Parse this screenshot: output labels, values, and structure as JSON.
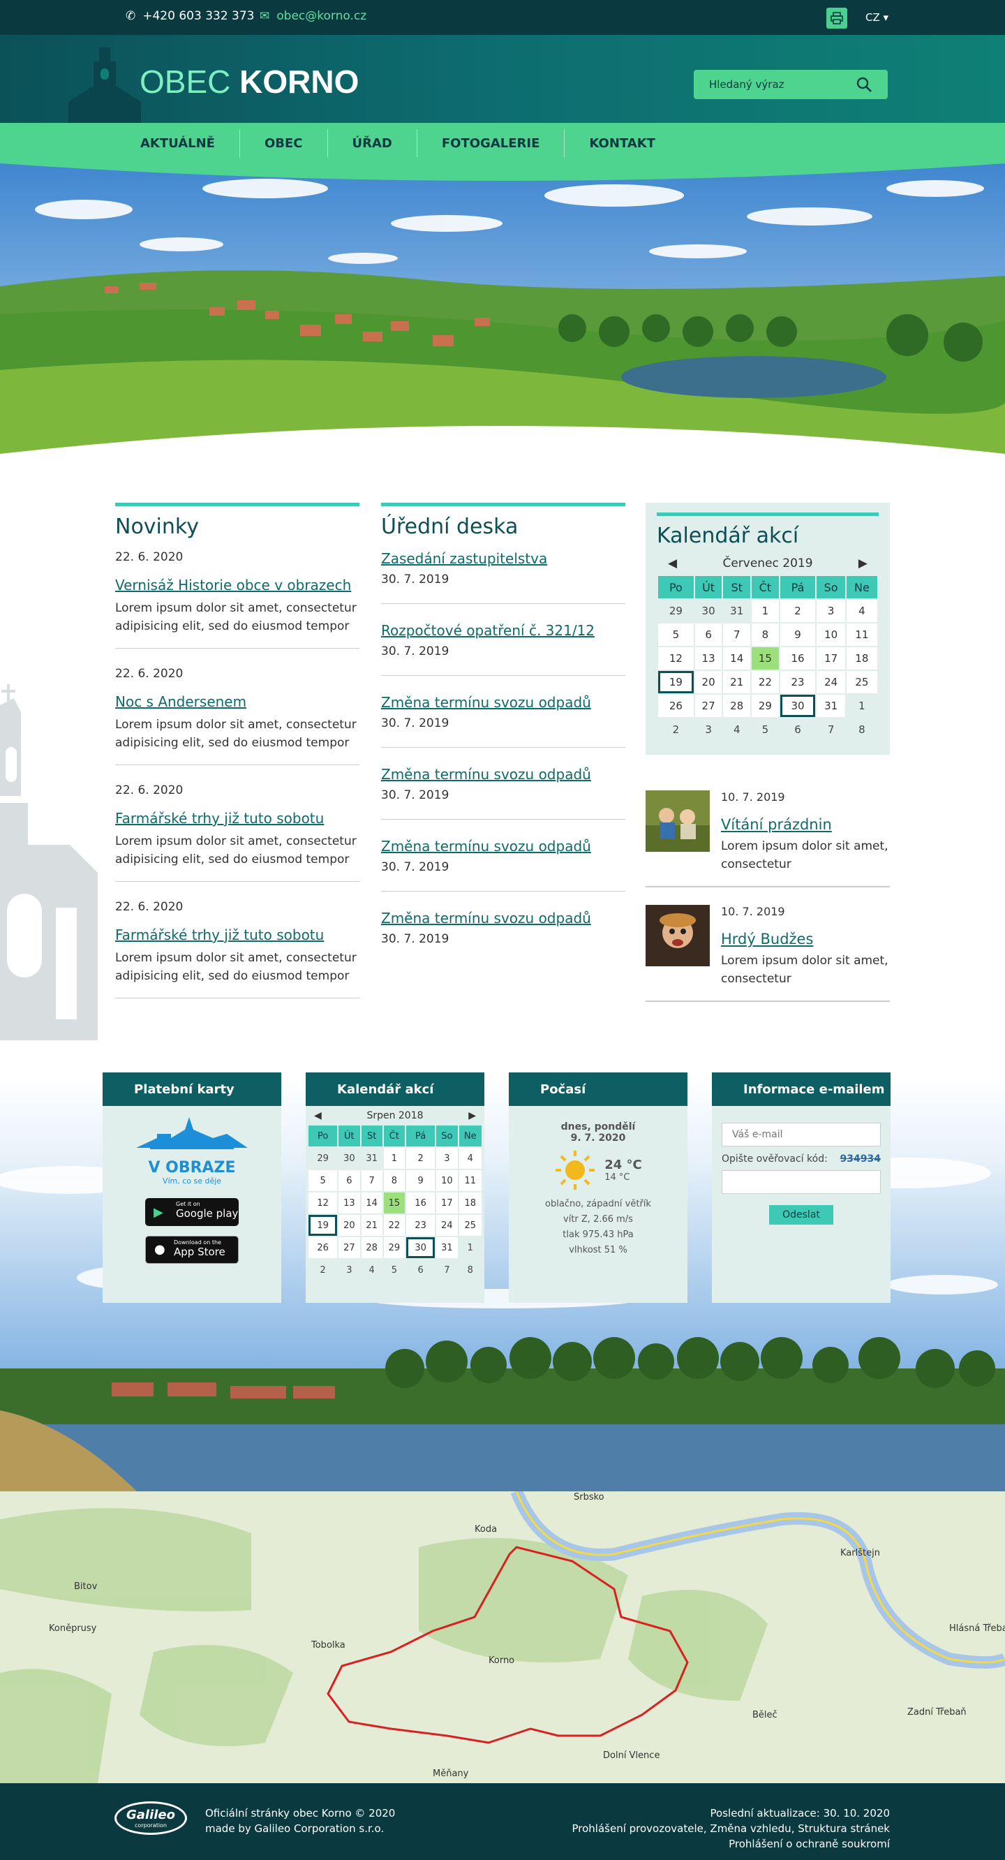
{
  "topbar": {
    "phone": "+420 603 332 373",
    "email": "obec@korno.cz",
    "lang": "CZ"
  },
  "header": {
    "logo_light": "OBEC",
    "logo_bold": "KORNO",
    "search_placeholder": "Hledaný výraz"
  },
  "nav": [
    "AKTUÁLNĚ",
    "OBEC",
    "ÚŘAD",
    "FOTOGALERIE",
    "KONTAKT"
  ],
  "news": {
    "title": "Novinky",
    "items": [
      {
        "date": "22. 6. 2020",
        "title": "Vernisáž Historie obce v obrazech",
        "text": "Lorem ipsum dolor sit amet, consectetur adipisicing elit, sed do eiusmod tempor"
      },
      {
        "date": "22. 6. 2020",
        "title": "Noc s Andersenem",
        "text": "Lorem ipsum dolor sit amet, consectetur adipisicing elit, sed do eiusmod tempor"
      },
      {
        "date": "22. 6. 2020",
        "title": "Farmářské trhy již tuto sobotu",
        "text": "Lorem ipsum dolor sit amet, consectetur adipisicing elit, sed do eiusmod tempor"
      },
      {
        "date": "22. 6. 2020",
        "title": "Farmářské trhy již tuto sobotu",
        "text": "Lorem ipsum dolor sit amet, consectetur adipisicing elit, sed do eiusmod tempor"
      }
    ]
  },
  "board": {
    "title": "Úřední deska",
    "items": [
      {
        "title": "Zasedání zastupitelstva",
        "date": "30. 7. 2019"
      },
      {
        "title": "Rozpočtové opatření č. 321/12",
        "date": "30. 7. 2019"
      },
      {
        "title": "Změna termínu svozu odpadů",
        "date": "30. 7. 2019"
      },
      {
        "title": "Změna termínu svozu odpadů",
        "date": "30. 7. 2019"
      },
      {
        "title": "Změna termínu svozu odpadů",
        "date": "30. 7. 2019"
      },
      {
        "title": "Změna termínu svozu odpadů",
        "date": "30. 7. 2019"
      }
    ]
  },
  "calendar": {
    "title": "Kalendář akcí",
    "month": "Červenec 2019",
    "weekdays": [
      "Po",
      "Út",
      "St",
      "Čt",
      "Pá",
      "So",
      "Ne"
    ],
    "weeks": [
      [
        "29",
        "30",
        "31",
        "1",
        "2",
        "3",
        "4"
      ],
      [
        "5",
        "6",
        "7",
        "8",
        "9",
        "10",
        "11"
      ],
      [
        "12",
        "13",
        "14",
        "15",
        "16",
        "17",
        "18"
      ],
      [
        "19",
        "20",
        "21",
        "22",
        "23",
        "24",
        "25"
      ],
      [
        "26",
        "27",
        "28",
        "29",
        "30",
        "31",
        "1"
      ],
      [
        "2",
        "3",
        "4",
        "5",
        "6",
        "7",
        "8"
      ]
    ]
  },
  "events": [
    {
      "date": "10. 7. 2019",
      "title": "Vítání prázdnin",
      "text": "Lorem ipsum dolor sit amet, consectetur"
    },
    {
      "date": "10. 7. 2019",
      "title": "Hrdý Budžes",
      "text": "Lorem ipsum dolor sit amet, consectetur"
    }
  ],
  "widgets": {
    "cards": {
      "title": "Platební karty",
      "brand": "V OBRAZE",
      "tagline": "Vím, co se děje",
      "google": "Get it on",
      "google2": "Google play",
      "apple": "Download on the",
      "apple2": "App Store"
    },
    "cal2": {
      "title": "Kalendář akcí",
      "month": "Srpen 2018",
      "weeks": [
        [
          "29",
          "30",
          "31",
          "1",
          "2",
          "3",
          "4"
        ],
        [
          "5",
          "6",
          "7",
          "8",
          "9",
          "10",
          "11"
        ],
        [
          "12",
          "13",
          "14",
          "15",
          "16",
          "17",
          "18"
        ],
        [
          "19",
          "20",
          "21",
          "22",
          "23",
          "24",
          "25"
        ],
        [
          "26",
          "27",
          "28",
          "29",
          "30",
          "31",
          "1"
        ],
        [
          "2",
          "3",
          "4",
          "5",
          "6",
          "7",
          "8"
        ]
      ]
    },
    "weather": {
      "title": "Počasí",
      "day": "dnes, pondělí",
      "date": "9. 7. 2020",
      "temp": "24 °C",
      "temp2": "14 °C",
      "l1": "oblačno, západní větřík",
      "l2": "vítr Z, 2.66 m/s",
      "l3": "tlak 975.43 hPa",
      "l4": "vlhkost 51 %"
    },
    "email": {
      "title": "Informace e-mailem",
      "placeholder": "Váš e-mail",
      "captcha_label": "Opište ověřovací kód:",
      "captcha": "934934",
      "submit": "Odeslat"
    }
  },
  "map": {
    "labels": [
      "Srbsko",
      "Karlštejn",
      "Koda",
      "Bitov",
      "Koněprusy",
      "Tobolka",
      "Korno",
      "Běleč",
      "Hlásná Třebaň",
      "Zadní Třebaň",
      "Měňany",
      "Dolní Vlence"
    ]
  },
  "footer": {
    "l1": "Oficiální stránky obec Korno © 2020",
    "l2": "made by",
    "l2link": "Galileo Corporation s.r.o.",
    "r1": "Poslední aktualizace: 30. 10. 2020",
    "r2a": "Prohlášení provozovatele",
    "r2b": "Změna vzhledu",
    "r2c": "Struktura stránek",
    "r3": "Prohlášení o ochraně soukromí",
    "logo": "Galileo",
    "logo2": "corporation"
  }
}
